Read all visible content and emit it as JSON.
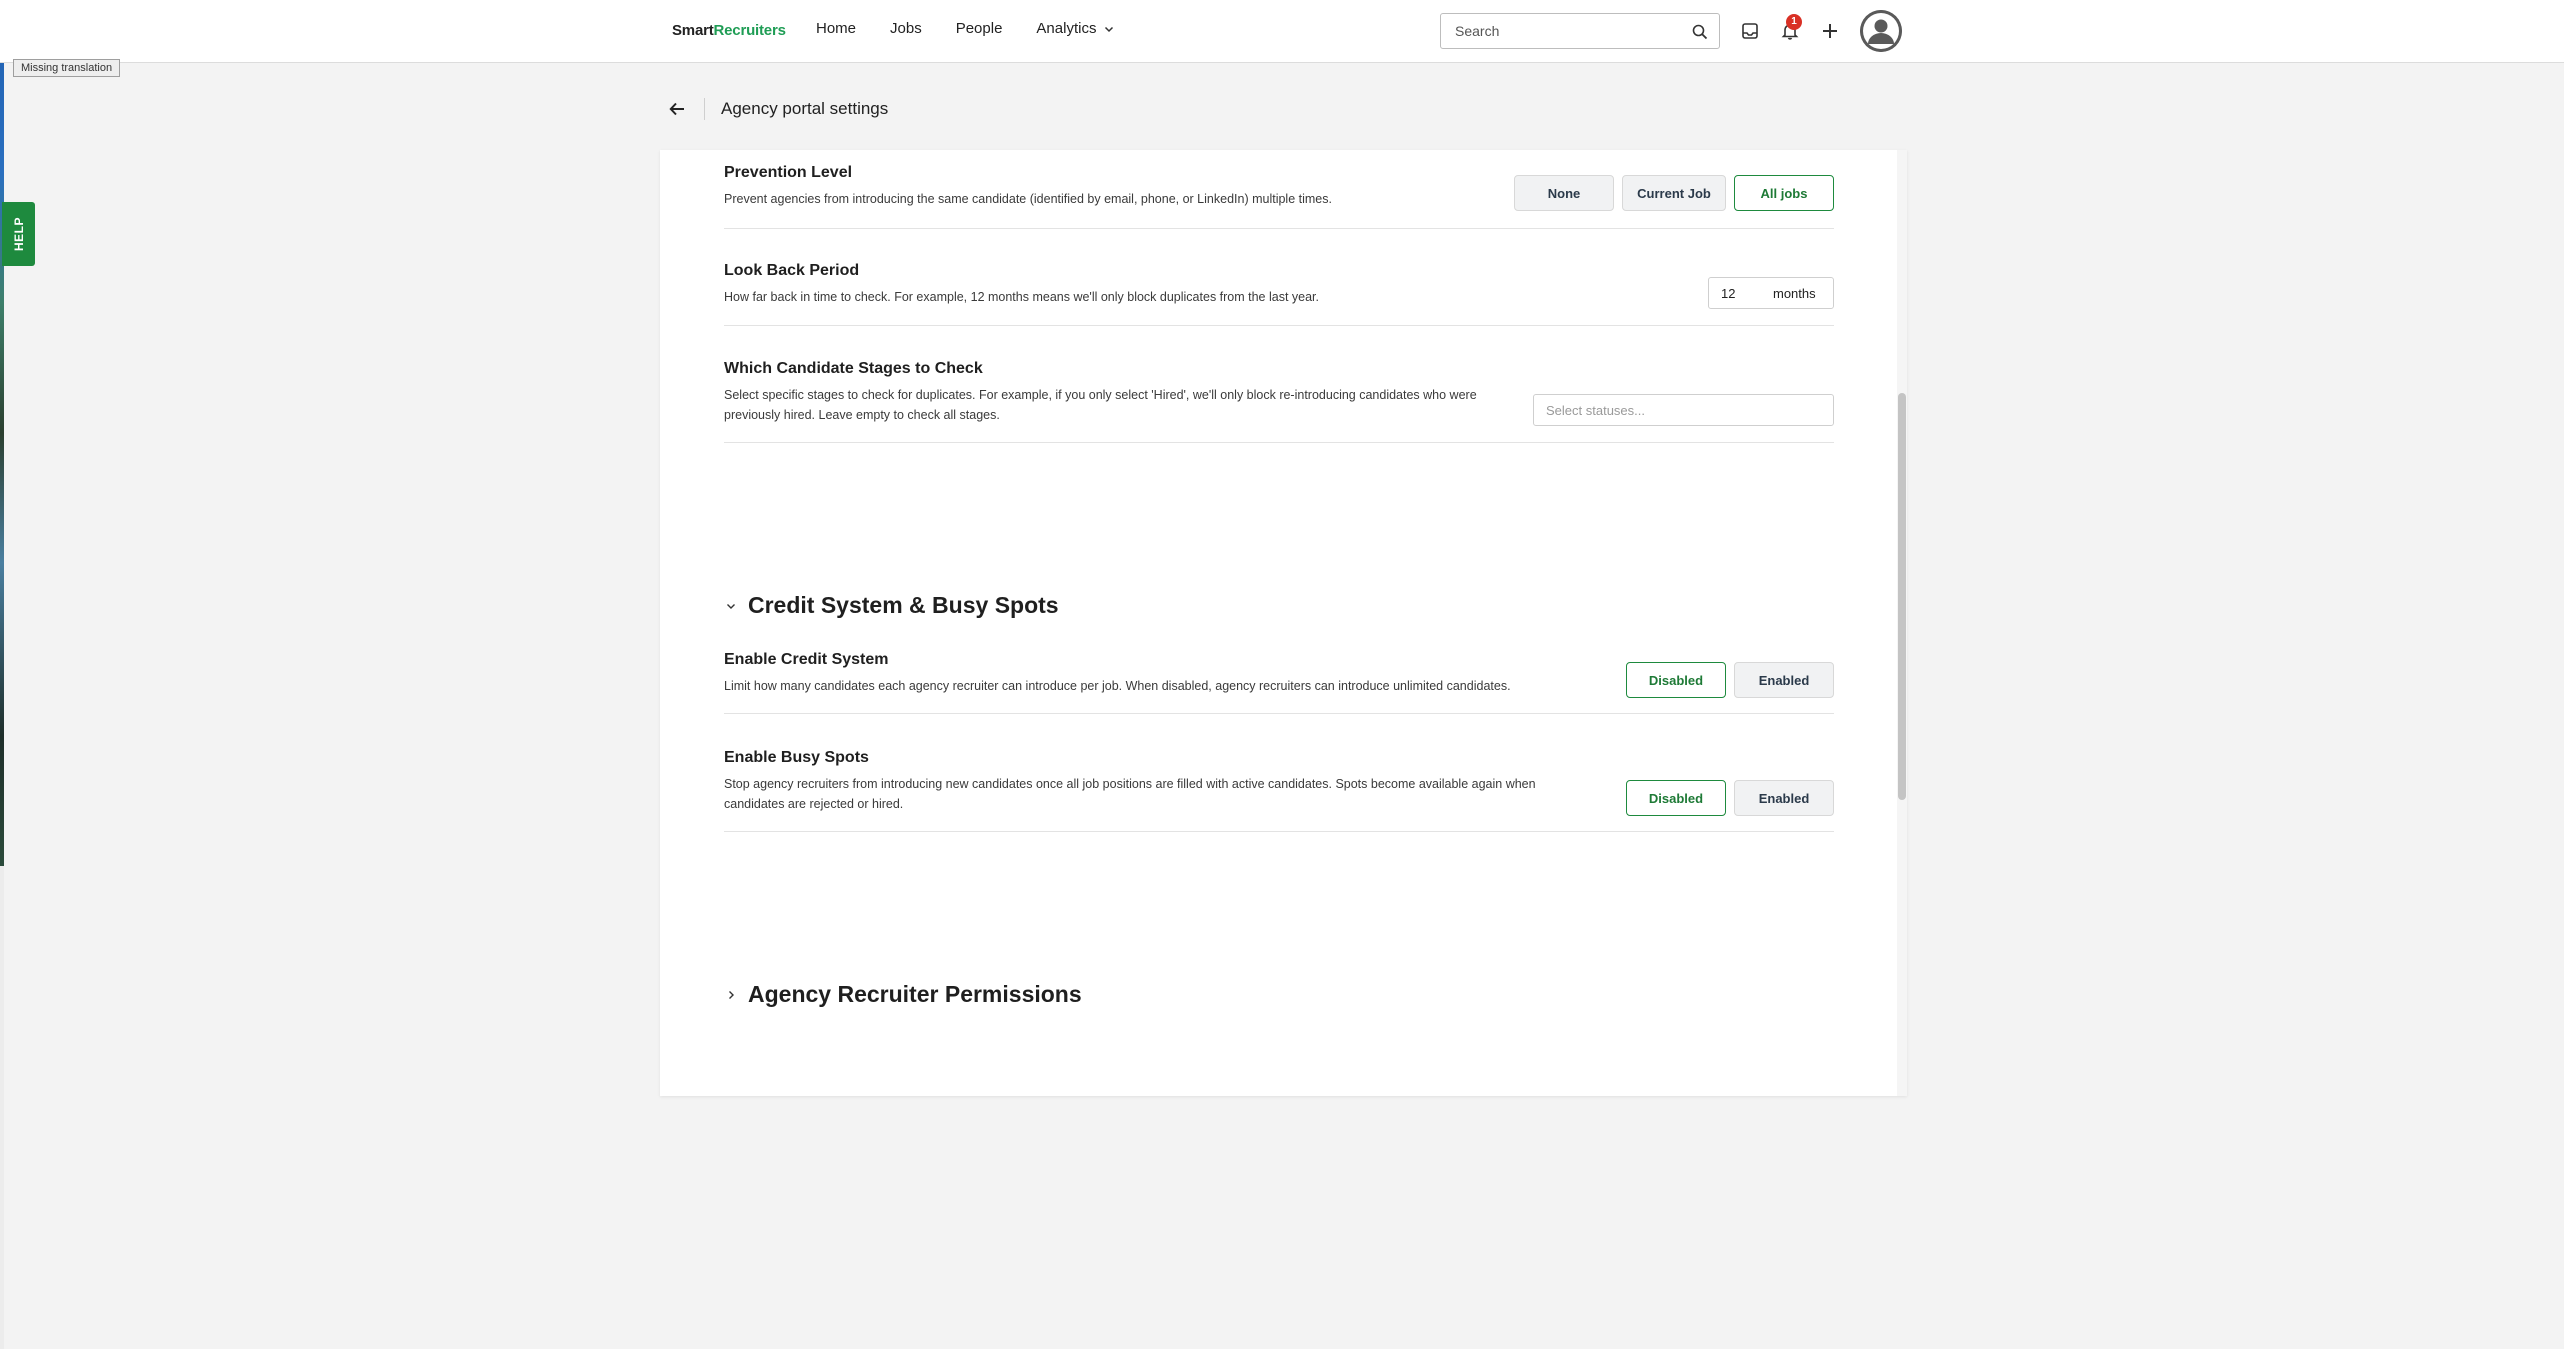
{
  "topbar": {
    "logo_smart": "Smart",
    "logo_recruiters": "Recruiters",
    "nav": [
      "Home",
      "Jobs",
      "People",
      "Analytics"
    ],
    "search_placeholder": "Search",
    "notification_count": "1"
  },
  "tooltip": "Missing translation",
  "help_tab": "HELP",
  "page": {
    "title": "Agency portal settings"
  },
  "duplicates": {
    "prevention": {
      "title": "Prevention Level",
      "description": "Prevent agencies from introducing the same candidate (identified by email, phone, or LinkedIn) multiple times.",
      "options": [
        "None",
        "Current Job",
        "All jobs"
      ],
      "selected": "All jobs"
    },
    "lookback": {
      "title": "Look Back Period",
      "description": "How far back in time to check. For example, 12 months means we'll only block duplicates from the last year.",
      "value": "12",
      "unit": "months"
    },
    "stages": {
      "title": "Which Candidate Stages to Check",
      "description": "Select specific stages to check for duplicates. For example, if you only select 'Hired', we'll only block re-introducing candidates who were previously hired. Leave empty to check all stages.",
      "placeholder": "Select statuses..."
    }
  },
  "credit_section": {
    "title": "Credit System & Busy Spots",
    "expanded": true,
    "credit": {
      "title": "Enable Credit System",
      "description": "Limit how many candidates each agency recruiter can introduce per job. When disabled, agency recruiters can introduce unlimited candidates.",
      "options": [
        "Disabled",
        "Enabled"
      ],
      "selected": "Disabled"
    },
    "busy": {
      "title": "Enable Busy Spots",
      "description": "Stop agency recruiters from introducing new candidates once all job positions are filled with active candidates. Spots become available again when candidates are rejected or hired.",
      "options": [
        "Disabled",
        "Enabled"
      ],
      "selected": "Disabled"
    }
  },
  "permissions_section": {
    "title": "Agency Recruiter Permissions",
    "expanded": false
  },
  "colors": {
    "accent_green": "#1e8a3e",
    "badge_red": "#d93025"
  }
}
